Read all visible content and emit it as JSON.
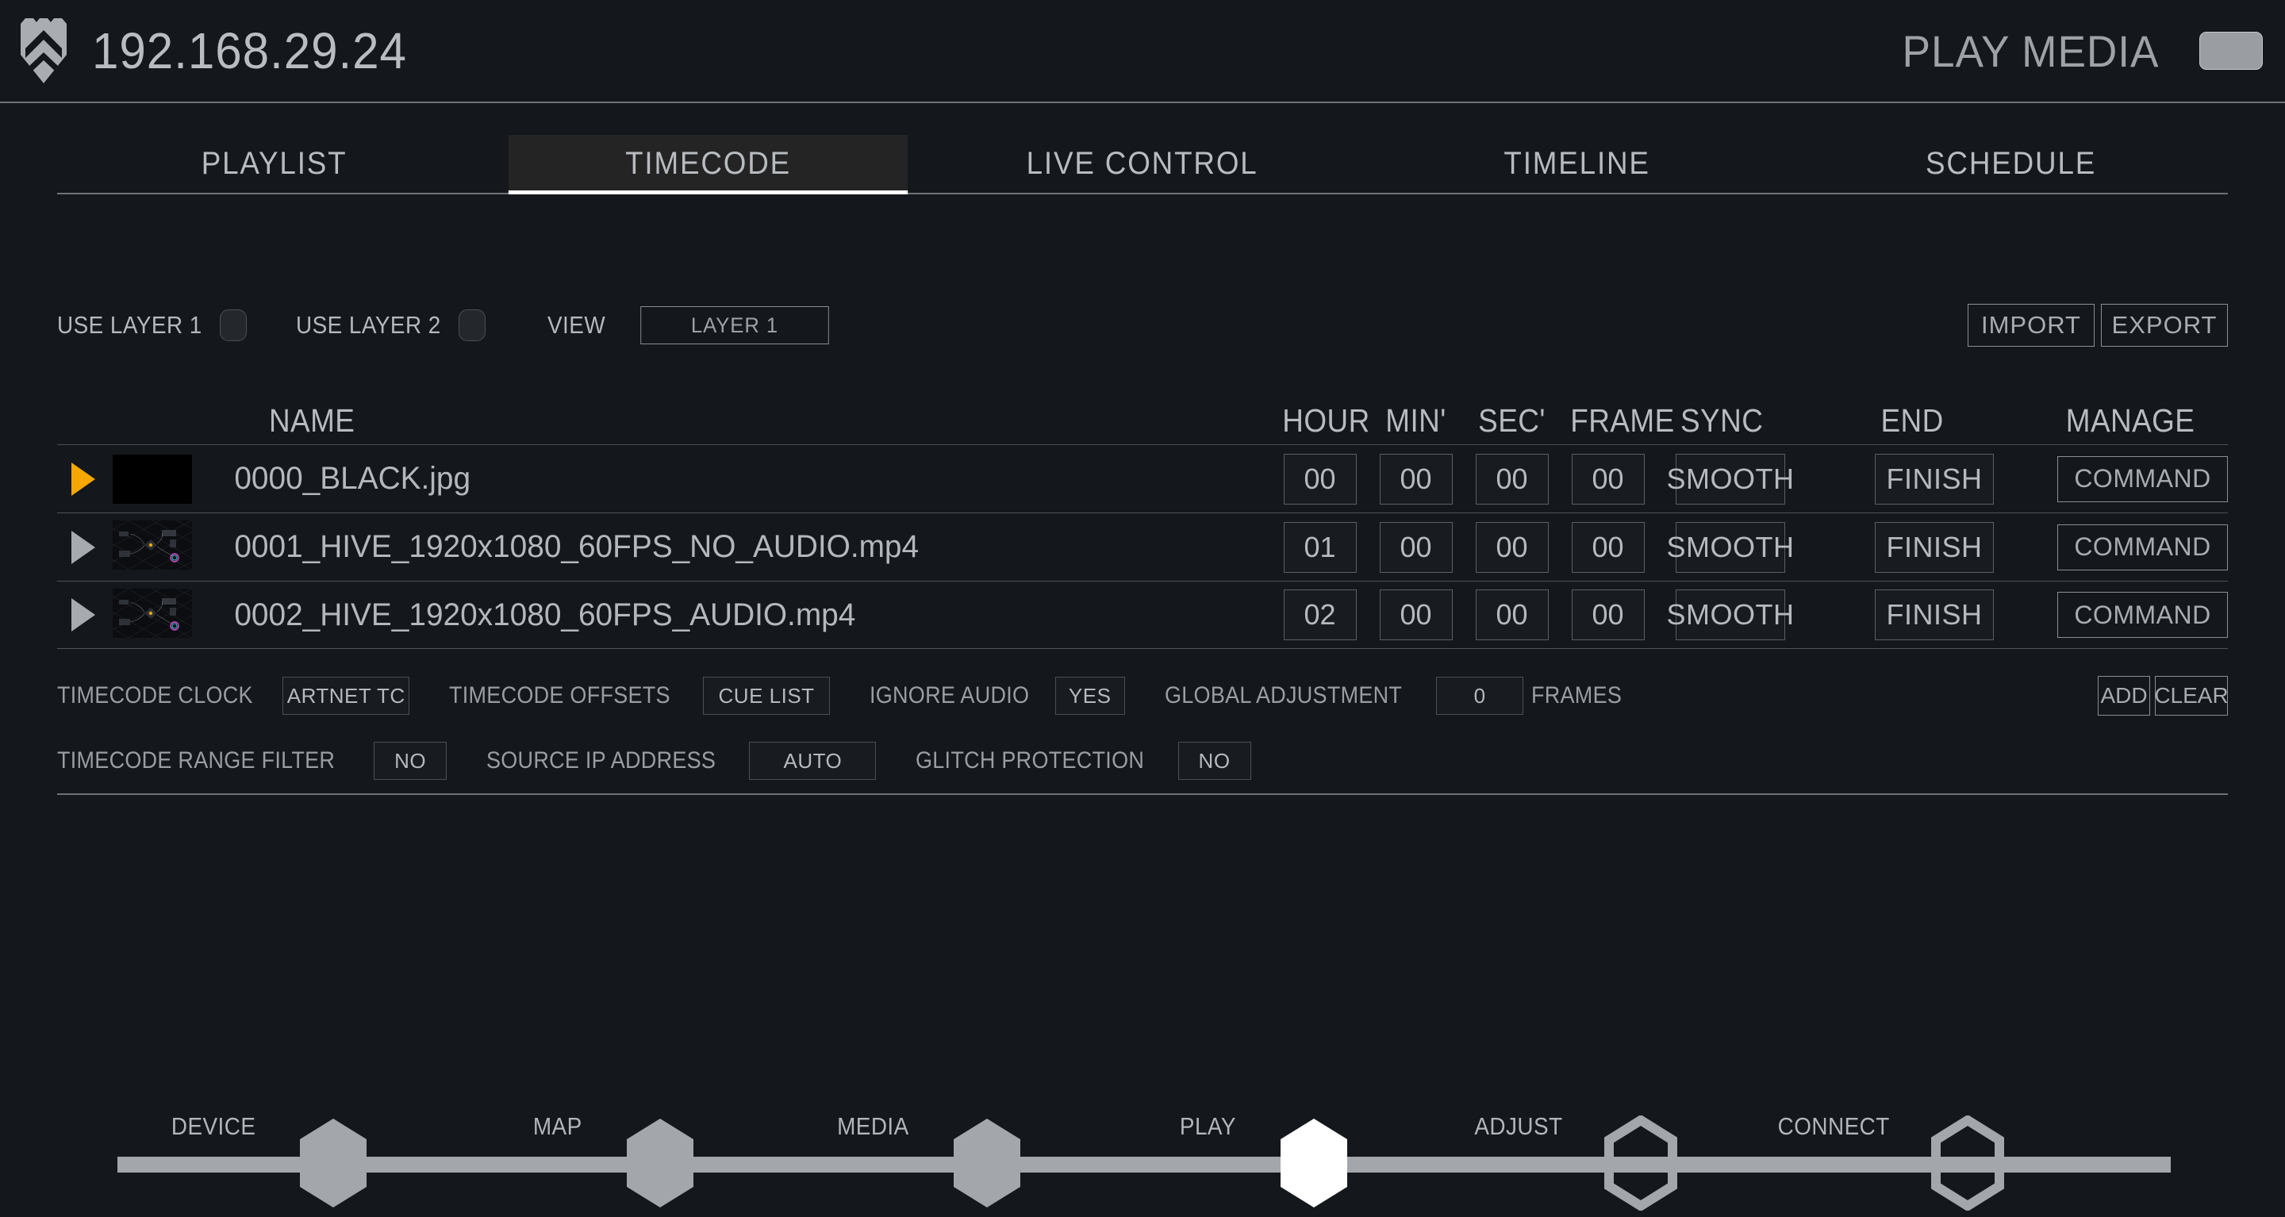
{
  "header": {
    "logo_icon": "hive-shield-logo-icon",
    "ip_address": "192.168.29.24",
    "mode_label": "PLAY MEDIA",
    "mode_button_label": ""
  },
  "tabs": [
    {
      "label": "PLAYLIST",
      "active": false
    },
    {
      "label": "TIMECODE",
      "active": true
    },
    {
      "label": "LIVE CONTROL",
      "active": false
    },
    {
      "label": "TIMELINE",
      "active": false
    },
    {
      "label": "SCHEDULE",
      "active": false
    }
  ],
  "options": {
    "use_layer_1_label": "USE LAYER 1",
    "use_layer_2_label": "USE LAYER 2",
    "view_label": "VIEW",
    "view_value": "LAYER 1",
    "import_label": "IMPORT",
    "export_label": "EXPORT"
  },
  "table": {
    "columns": {
      "name": "NAME",
      "hour": "HOUR",
      "min": "MIN'",
      "sec": "SEC'",
      "frame": "FRAME",
      "sync": "SYNC",
      "end": "END",
      "manage": "MANAGE"
    },
    "rows": [
      {
        "name": "0000_BLACK.jpg",
        "hour": "00",
        "min": "00",
        "sec": "00",
        "frame": "00",
        "sync": "SMOOTH",
        "end": "FINISH",
        "manage": "COMMAND",
        "playing": true,
        "thumb": "black"
      },
      {
        "name": "0001_HIVE_1920x1080_60FPS_NO_AUDIO.mp4",
        "hour": "01",
        "min": "00",
        "sec": "00",
        "frame": "00",
        "sync": "SMOOTH",
        "end": "FINISH",
        "manage": "COMMAND",
        "playing": false,
        "thumb": "node-graph"
      },
      {
        "name": "0002_HIVE_1920x1080_60FPS_AUDIO.mp4",
        "hour": "02",
        "min": "00",
        "sec": "00",
        "frame": "00",
        "sync": "SMOOTH",
        "end": "FINISH",
        "manage": "COMMAND",
        "playing": false,
        "thumb": "node-graph"
      }
    ]
  },
  "settings": {
    "timecode_clock_label": "TIMECODE CLOCK",
    "timecode_clock_value": "ARTNET TC",
    "timecode_offsets_label": "TIMECODE OFFSETS",
    "timecode_offsets_value": "CUE LIST",
    "ignore_audio_label": "IGNORE AUDIO",
    "ignore_audio_value": "YES",
    "global_adjustment_label": "GLOBAL ADJUSTMENT",
    "global_adjustment_value": "0",
    "frames_label": "FRAMES",
    "add_label": "ADD",
    "clear_label": "CLEAR",
    "range_filter_label": "TIMECODE RANGE FILTER",
    "range_filter_value": "NO",
    "source_ip_label": "SOURCE IP ADDRESS",
    "source_ip_value": "AUTO",
    "glitch_protection_label": "GLITCH PROTECTION",
    "glitch_protection_value": "NO"
  },
  "stepper": [
    {
      "label": "DEVICE",
      "state": "done"
    },
    {
      "label": "MAP",
      "state": "done"
    },
    {
      "label": "MEDIA",
      "state": "done"
    },
    {
      "label": "PLAY",
      "state": "current"
    },
    {
      "label": "ADJUST",
      "state": "todo"
    },
    {
      "label": "CONNECT",
      "state": "todo"
    }
  ],
  "colors": {
    "background": "#14171b",
    "accent_orange": "#f6a700",
    "text": "#b4b7bb",
    "line": "#6e7276",
    "active_tab_bg": "#242424",
    "current_step": "#ffffff",
    "step_gray": "#a3a7ab"
  }
}
